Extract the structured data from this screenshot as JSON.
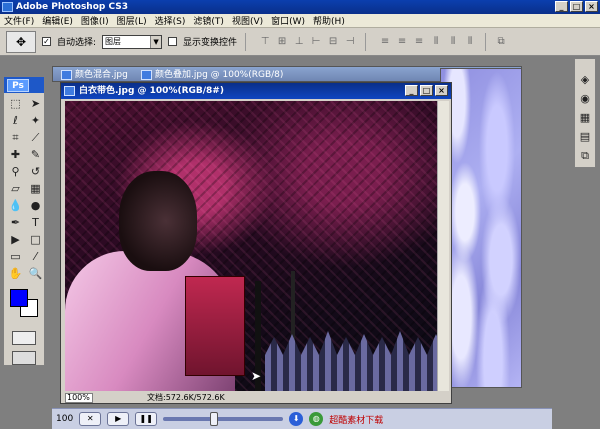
{
  "window": {
    "title": "Adobe Photoshop CS3",
    "btn_min": "_",
    "btn_max": "□",
    "btn_close": "×"
  },
  "menu": [
    "文件(F)",
    "编辑(E)",
    "图像(I)",
    "图层(L)",
    "选择(S)",
    "滤镜(T)",
    "视图(V)",
    "窗口(W)",
    "帮助(H)"
  ],
  "options": {
    "auto_select_label": "自动选择:",
    "auto_select_value": "图层",
    "show_transform_label": "显示变换控件"
  },
  "docs": {
    "back_tab_1": "颜色混合.jpg",
    "back_tab_2": "颜色叠加.jpg @ 100%(RGB/8)",
    "main_title": "白衣带色.jpg @ 100%(RGB/8#)",
    "zoom": "100%",
    "doc_size": "文档:572.6K/572.6K"
  },
  "toolbox": {
    "logo": "Ps"
  },
  "player": {
    "time": "100",
    "link": "超酷素材下载",
    "progress": 0.42
  }
}
